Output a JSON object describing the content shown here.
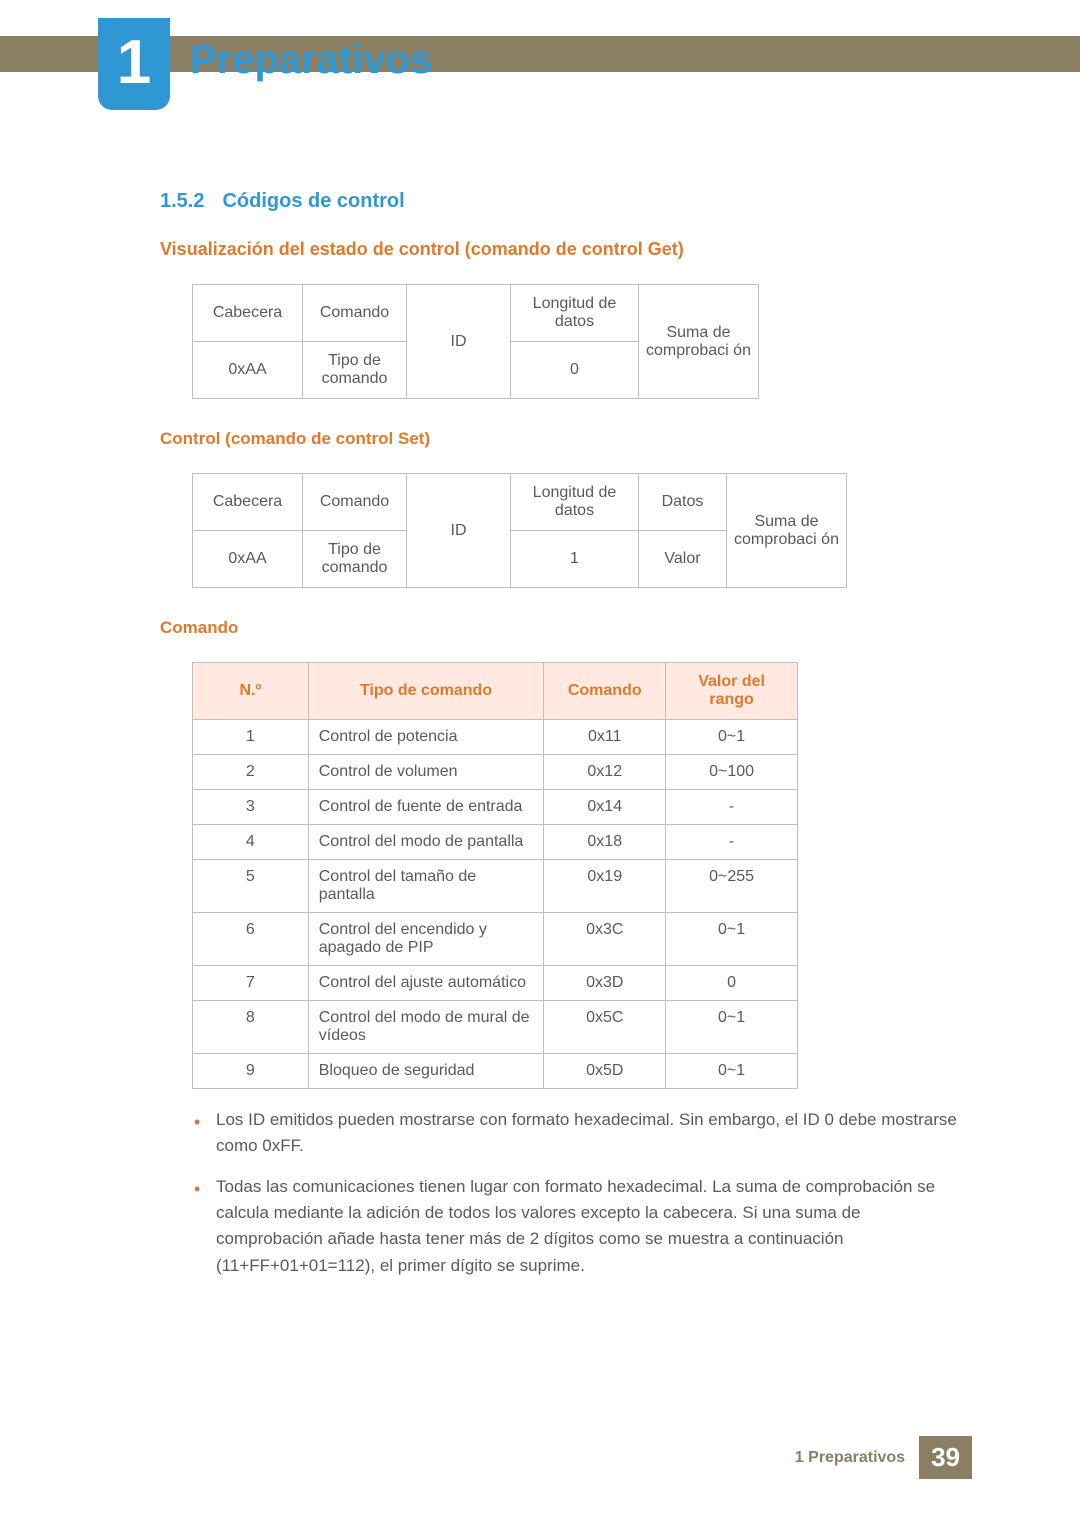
{
  "header": {
    "chapter_number": "1",
    "chapter_title": "Preparativos"
  },
  "section": {
    "number": "1.5.2",
    "title": "Códigos de control"
  },
  "get_block": {
    "heading": "Visualización del estado de control (comando de control Get)",
    "table": {
      "r1c1": "Cabecera",
      "r1c2": "Comando",
      "id": "ID",
      "r1c4": "Longitud de datos",
      "sum": "Suma de comprobaci ón",
      "r2c1": "0xAA",
      "r2c2": "Tipo de comando",
      "r2c4": "0"
    }
  },
  "set_block": {
    "heading": "Control (comando de control Set)",
    "table": {
      "r1c1": "Cabecera",
      "r1c2": "Comando",
      "id": "ID",
      "r1c4": "Longitud de datos",
      "r1c5": "Datos",
      "sum": "Suma de comprobaci ón",
      "r2c1": "0xAA",
      "r2c2": "Tipo de comando",
      "r2c4": "1",
      "r2c5": "Valor"
    }
  },
  "command_block": {
    "heading": "Comando",
    "headers": {
      "num": "N.º",
      "tipo": "Tipo de comando",
      "cmd": "Comando",
      "rango": "Valor del rango"
    },
    "rows": [
      {
        "n": "1",
        "tipo": "Control de potencia",
        "cmd": "0x11",
        "rango": "0~1"
      },
      {
        "n": "2",
        "tipo": "Control de volumen",
        "cmd": "0x12",
        "rango": "0~100"
      },
      {
        "n": "3",
        "tipo": "Control de fuente de entrada",
        "cmd": "0x14",
        "rango": "-"
      },
      {
        "n": "4",
        "tipo": "Control del modo de pantalla",
        "cmd": "0x18",
        "rango": "-"
      },
      {
        "n": "5",
        "tipo": "Control del tamaño de pantalla",
        "cmd": "0x19",
        "rango": "0~255"
      },
      {
        "n": "6",
        "tipo": "Control del encendido y apagado de PIP",
        "cmd": "0x3C",
        "rango": "0~1"
      },
      {
        "n": "7",
        "tipo": "Control del ajuste automático",
        "cmd": "0x3D",
        "rango": "0"
      },
      {
        "n": "8",
        "tipo": "Control del modo de mural de vídeos",
        "cmd": "0x5C",
        "rango": "0~1"
      },
      {
        "n": "9",
        "tipo": "Bloqueo de seguridad",
        "cmd": "0x5D",
        "rango": "0~1"
      }
    ]
  },
  "notes": [
    "Los ID emitidos pueden mostrarse con formato hexadecimal. Sin embargo, el ID 0 debe mostrarse como 0xFF.",
    "Todas las comunicaciones tienen lugar con formato hexadecimal. La suma de comprobación se calcula mediante la adición de todos los valores excepto la cabecera. Si una suma de comprobación añade hasta tener más de 2 dígitos como se muestra a continuación (11+FF+01+01=112), el primer dígito se suprime."
  ],
  "footer": {
    "label": "1 Preparativos",
    "page": "39"
  }
}
